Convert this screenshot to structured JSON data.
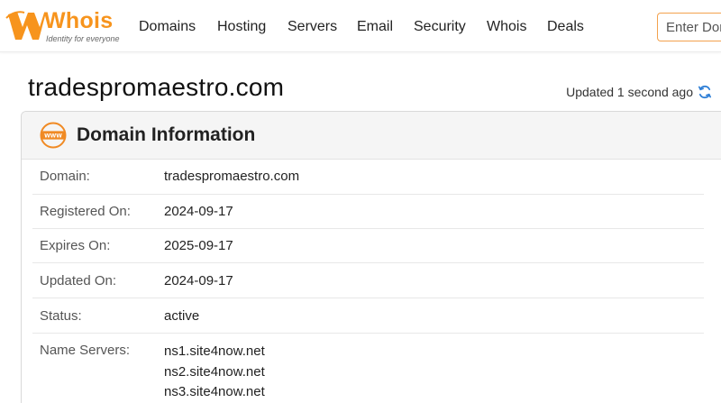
{
  "brand": {
    "name": "Whois",
    "tagline": "Identity for everyone",
    "color": "#f7941d"
  },
  "nav": {
    "items": [
      {
        "id": "domains",
        "label": "Domains"
      },
      {
        "id": "hosting",
        "label": "Hosting"
      },
      {
        "id": "servers",
        "label": "Servers"
      },
      {
        "id": "email",
        "label": "Email"
      },
      {
        "id": "security",
        "label": "Security"
      },
      {
        "id": "whois",
        "label": "Whois"
      },
      {
        "id": "deals",
        "label": "Deals"
      }
    ]
  },
  "search": {
    "placeholder": "Enter Domain",
    "value": ""
  },
  "page": {
    "title": "tradespromaestro.com",
    "updated_text": "Updated 1 second ago",
    "refresh_icon": "refresh-icon"
  },
  "domain_info": {
    "icon": "www-icon",
    "heading": "Domain Information",
    "rows": [
      {
        "label": "Domain:",
        "value": "tradespromaestro.com"
      },
      {
        "label": "Registered On:",
        "value": "2024-09-17"
      },
      {
        "label": "Expires On:",
        "value": "2025-09-17"
      },
      {
        "label": "Updated On:",
        "value": "2024-09-17"
      },
      {
        "label": "Status:",
        "value": "active"
      }
    ],
    "name_servers": {
      "label": "Name Servers:",
      "values": [
        "ns1.site4now.net",
        "ns2.site4now.net",
        "ns3.site4now.net"
      ]
    }
  }
}
